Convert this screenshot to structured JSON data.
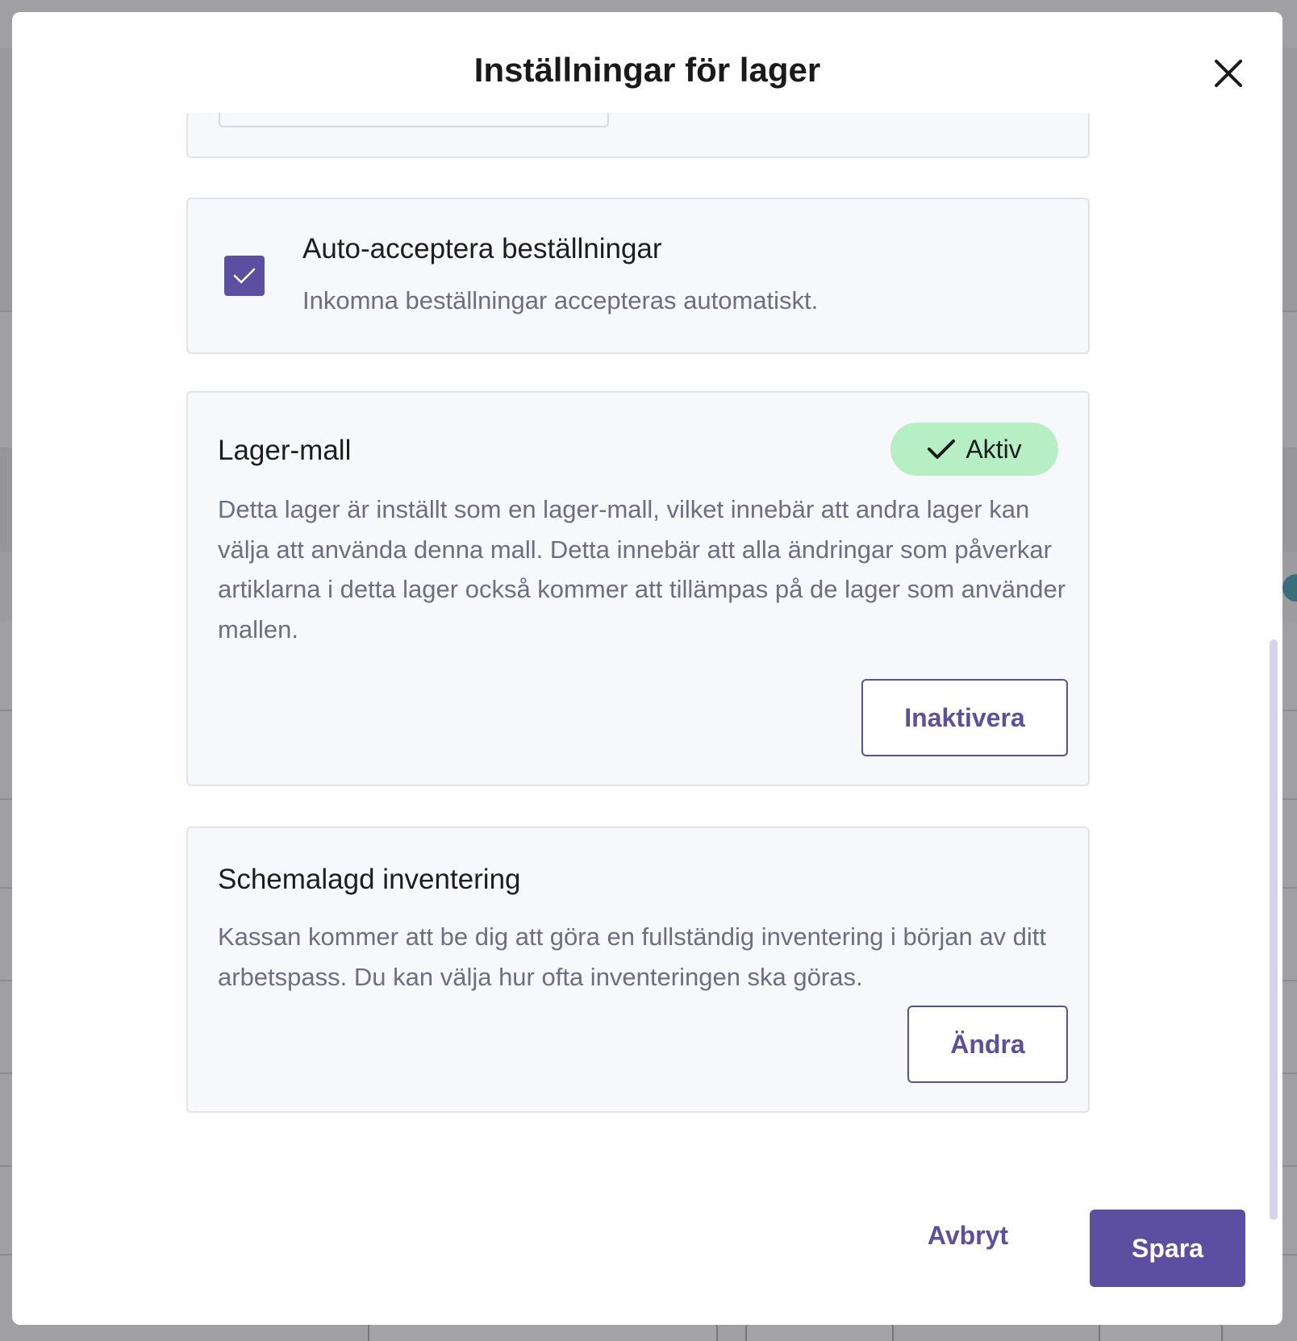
{
  "modal": {
    "title": "Inställningar för lager",
    "close_icon": "close-icon"
  },
  "auto_accept": {
    "checked": true,
    "title": "Auto-acceptera beställningar",
    "description": "Inkomna beställningar accepteras automatiskt."
  },
  "template": {
    "title": "Lager-mall",
    "badge": "Aktiv",
    "description": "Detta lager är inställt som en lager-mall, vilket innebär att andra lager kan välja att använda denna mall. Detta innebär att alla ändringar som påverkar artiklarna i detta lager också kommer att tillämpas på de lager som använder mallen.",
    "button": "Inaktivera"
  },
  "schedule": {
    "title": "Schemalagd inventering",
    "description": "Kassan kommer att be dig att göra en fullständig inventering i början av ditt arbetspass. Du kan välja hur ofta inventeringen ska göras.",
    "button": "Ändra"
  },
  "footer": {
    "cancel": "Avbryt",
    "save": "Spara"
  },
  "colors": {
    "accent": "#5c4fa2",
    "badge_bg": "#b7efc5"
  }
}
